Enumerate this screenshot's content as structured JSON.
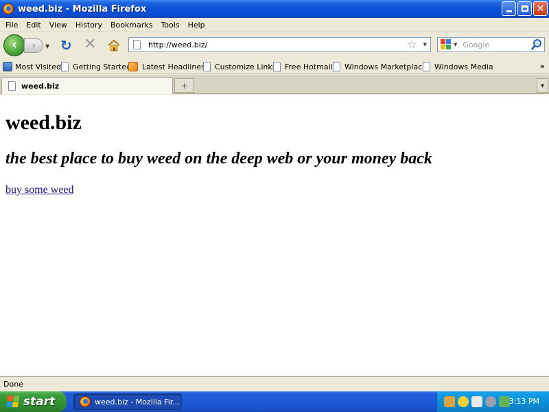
{
  "window": {
    "title": "weed.biz - Mozilla Firefox"
  },
  "menu": {
    "items": [
      {
        "label": "File",
        "accel": "F"
      },
      {
        "label": "Edit",
        "accel": "E"
      },
      {
        "label": "View",
        "accel": "V"
      },
      {
        "label": "History",
        "accel": "s"
      },
      {
        "label": "Bookmarks",
        "accel": "B"
      },
      {
        "label": "Tools",
        "accel": "T"
      },
      {
        "label": "Help",
        "accel": "H"
      }
    ]
  },
  "nav": {
    "url": "http://weed.biz/",
    "search_placeholder": "Google",
    "icons": [
      "back-icon",
      "forward-icon",
      "reload-icon",
      "stop-icon",
      "home-icon",
      "star-icon",
      "search-icon"
    ]
  },
  "bookmarks": {
    "items": [
      {
        "label": "Most Visited",
        "icon": "most-visited-icon"
      },
      {
        "label": "Getting Started",
        "icon": "page-icon"
      },
      {
        "label": "Latest Headlines",
        "icon": "rss-icon"
      },
      {
        "label": "Customize Links",
        "icon": "page-icon"
      },
      {
        "label": "Free Hotmail",
        "icon": "page-icon"
      },
      {
        "label": "Windows Marketplace",
        "icon": "page-icon"
      },
      {
        "label": "Windows Media",
        "icon": "page-icon"
      }
    ],
    "more": "»"
  },
  "tabs": {
    "items": [
      {
        "label": "weed.biz",
        "active": true
      }
    ],
    "new_tab_glyph": "+"
  },
  "page": {
    "heading": "weed.biz",
    "subheading": "the best place to buy weed on the deep web or your money back",
    "link_text": "buy some weed"
  },
  "status": {
    "text": "Done"
  },
  "taskbar": {
    "start_label": "start",
    "task_label": "weed.biz - Mozilla Fir...",
    "clock": "3:13 PM"
  },
  "colors": {
    "titlebar_blue": "#0a50d8",
    "link_color": "#1a0d8c",
    "start_green": "#3a9d3a",
    "tray_blue": "#0f8ed9"
  }
}
